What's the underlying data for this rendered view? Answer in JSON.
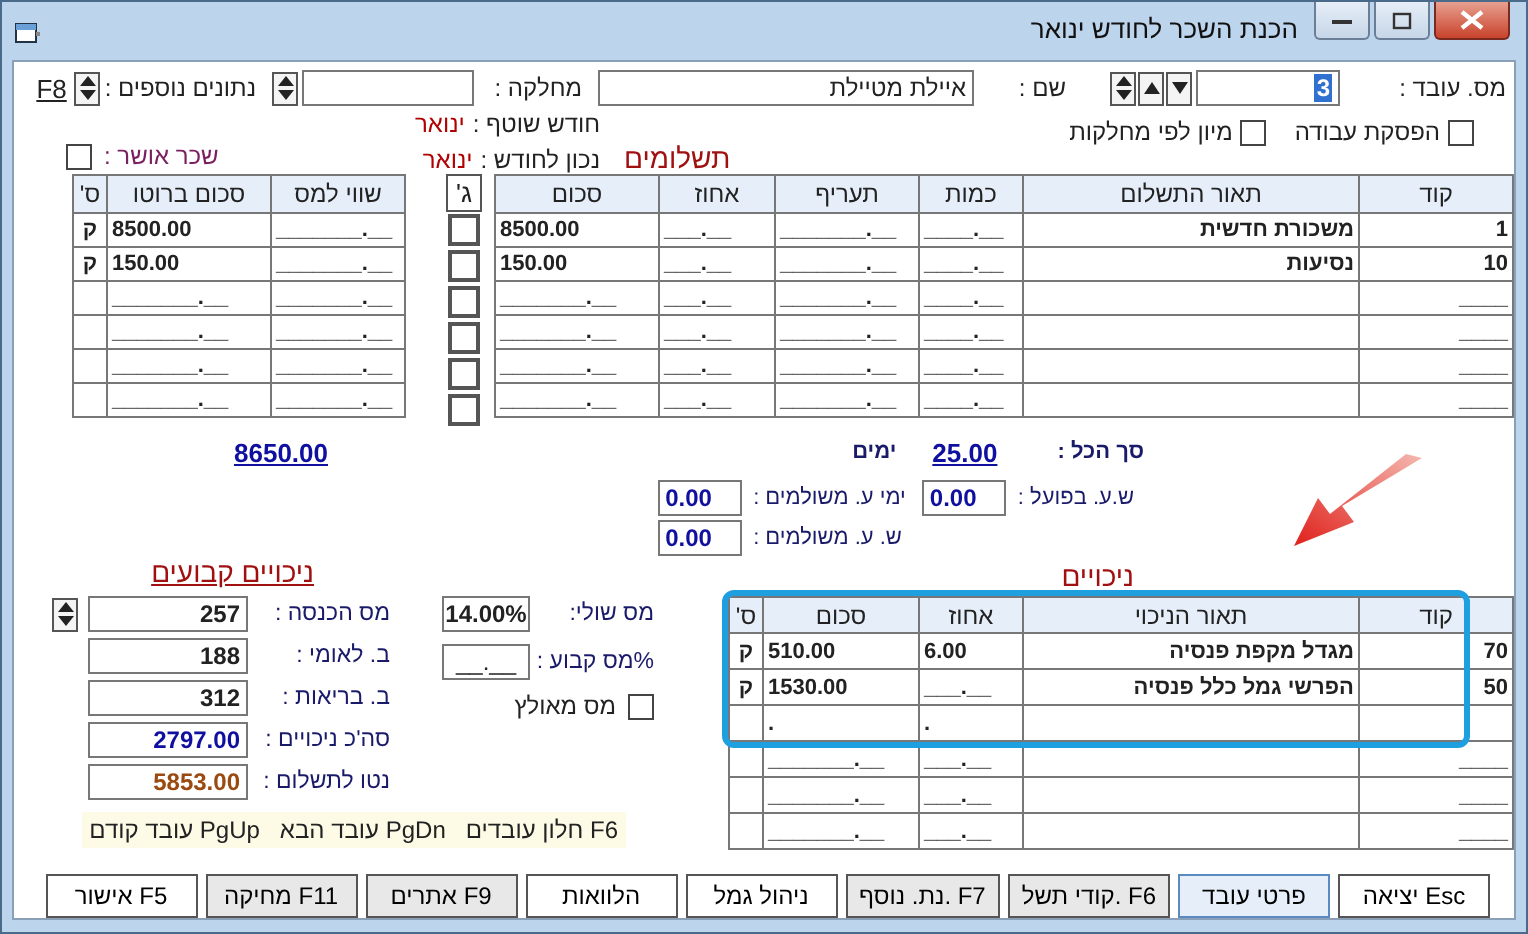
{
  "window": {
    "title": "הכנת השכר לחודש ינואר"
  },
  "header": {
    "employee_no": {
      "label": "מס. עובד :",
      "value": "3",
      "text_selected": true
    },
    "name": {
      "label": "שם :",
      "value": "איילת מטיילת"
    },
    "department": {
      "label": "מחלקה :"
    },
    "extra": {
      "label": "נתונים נוספים :",
      "key": "F8"
    }
  },
  "options": [
    {
      "label": "הפסקת עבודה",
      "checked": false
    },
    {
      "label": "מיון לפי מחלקות",
      "checked": false
    }
  ],
  "month_info": [
    {
      "label": "חודש שוטף :",
      "value": "ינואר"
    },
    {
      "label": "נכון לחודש :",
      "value": "ינואר"
    }
  ],
  "approved_wage": {
    "label": "שכר אושר :",
    "checked": false
  },
  "payments": {
    "title": "תשלומים",
    "columns": [
      "קוד",
      "תאור התשלום",
      "כמות",
      "תעריף",
      "אחוז",
      "סכום"
    ],
    "rows": [
      {
        "code": "1",
        "desc": "משכורת חדשית",
        "qty": "____.__",
        "rate": "_______.__",
        "pct": "___.__",
        "amount": "8500.00"
      },
      {
        "code": "10",
        "desc": "נסיעות",
        "qty": "____.__",
        "rate": "_______.__",
        "pct": "___.__",
        "amount": "150.00"
      },
      {
        "code": "____",
        "qty": "____.__",
        "rate": "_______.__",
        "pct": "___.__",
        "amount": "_______.__"
      },
      {
        "code": "____",
        "qty": "____.__",
        "rate": "_______.__",
        "pct": "___.__",
        "amount": "_______.__"
      },
      {
        "code": "____",
        "qty": "____.__",
        "rate": "_______.__",
        "pct": "___.__",
        "amount": "_______.__"
      },
      {
        "code": "____",
        "qty": "____.__",
        "rate": "_______.__",
        "pct": "___.__",
        "amount": "_______.__"
      }
    ],
    "flag_column": "ג'",
    "flags": [
      false,
      false,
      false,
      false,
      false,
      false
    ],
    "tax_columns": [
      "שווי למס",
      "סכום ברוטו",
      "ס'"
    ],
    "tax_rows": [
      {
        "worth": "_______.__",
        "gross": "8500.00",
        "s": "ק"
      },
      {
        "worth": "_______.__",
        "gross": "150.00",
        "s": "ק"
      },
      {
        "worth": "_______.__",
        "gross": "_______.__"
      },
      {
        "worth": "_______.__",
        "gross": "_______.__"
      },
      {
        "worth": "_______.__",
        "gross": "_______.__"
      },
      {
        "worth": "_______.__",
        "gross": "_______.__"
      }
    ]
  },
  "totals": {
    "gross": "8650.00",
    "total_label": "סך הכל :",
    "days_value": "25.00",
    "days_label": "ימים"
  },
  "hours": [
    {
      "label": "ש.ע. בפועל :",
      "value": "0.00"
    },
    {
      "label": "ימי ע. משולמים :",
      "value": "0.00"
    },
    {
      "label": "ש. ע. משולמים :",
      "value": "0.00"
    }
  ],
  "deductions": {
    "title": "ניכויים",
    "columns": [
      "קוד",
      "תאור הניכוי",
      "אחוז",
      "סכום",
      "ס'"
    ],
    "rows": [
      {
        "code": "70",
        "desc": "מגדל מקפת פנסיה",
        "pct": "6.00",
        "amount": "510.00",
        "s": "ק"
      },
      {
        "code": "50",
        "desc": "הפרשי גמל כלל פנסיה",
        "pct": "___.__",
        "amount": "1530.00",
        "s": "ק"
      },
      {
        "pct": ".",
        "amount": "."
      },
      {
        "code": "____",
        "pct": "___.__",
        "amount": "_______.__"
      },
      {
        "code": "____",
        "pct": "___.__",
        "amount": "_______.__"
      },
      {
        "code": "____",
        "pct": "___.__",
        "amount": "_______.__"
      }
    ]
  },
  "tax": {
    "marginal": {
      "label": "מס שולי:",
      "value": "14.00%"
    },
    "fixed": {
      "label": "%מס קבוע :",
      "value": "__.__"
    },
    "forced": {
      "label": "מס מאולץ",
      "checked": false
    }
  },
  "fixed_deductions": {
    "title": "ניכויים קבועים",
    "rows": [
      {
        "label": "מס הכנסה :",
        "value": "257",
        "kind": "spin"
      },
      {
        "label": "ב. לאומי :",
        "value": "188",
        "kind": "plain"
      },
      {
        "label": "ב. בריאות :",
        "value": "312",
        "kind": "plain"
      },
      {
        "label": "סה'כ ניכויים :",
        "value": "2797.00",
        "kind": "total"
      },
      {
        "label": "נטו לתשלום :",
        "value": "5853.00",
        "kind": "net"
      }
    ]
  },
  "hints": [
    "חלון עובדים F6",
    "עובד הבא PgDn",
    "עובד קודם PgUp"
  ],
  "buttons": [
    {
      "label": "יציאה Esc",
      "kind": "normal"
    },
    {
      "label": "פרטי עובד",
      "kind": "active"
    },
    {
      "label": "קודי תשל. F6",
      "kind": "grey"
    },
    {
      "label": "נת. נוסף. F7",
      "kind": "grey"
    },
    {
      "label": "ניהול גמל",
      "kind": "normal"
    },
    {
      "label": "הלוואות",
      "kind": "normal"
    },
    {
      "label": "אתרים F9",
      "kind": "grey"
    },
    {
      "label": "מחיקה F11",
      "kind": "grey"
    },
    {
      "label": "אישור F5",
      "kind": "normal"
    }
  ]
}
